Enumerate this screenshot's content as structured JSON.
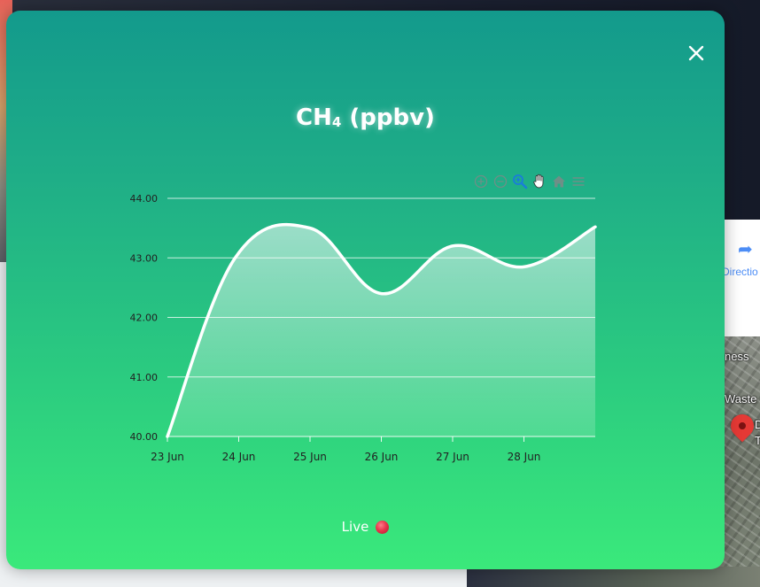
{
  "background": {
    "directions_label": "Directio",
    "map_labels": [
      "ness",
      "Waste",
      "D",
      "T"
    ]
  },
  "modal": {
    "title_main": "CH",
    "title_sub": "4",
    "title_unit": " (ppbv)",
    "close_icon": "close-icon",
    "live_label": "Live",
    "colors": {
      "gradient_top": "#139a8c",
      "gradient_bottom": "#3ae97b",
      "live_dot": "#e8364d"
    }
  },
  "toolbar": {
    "icons": [
      "zoom-in-icon",
      "zoom-out-icon",
      "magnifier-zoom-icon",
      "pan-hand-icon",
      "home-reset-icon",
      "menu-icon"
    ]
  },
  "chart_data": {
    "type": "area",
    "title": "CH4 (ppbv)",
    "x": [
      0,
      0.95,
      2,
      3,
      4,
      5,
      6
    ],
    "values": [
      40.0,
      43.0,
      43.5,
      42.4,
      43.2,
      42.85,
      43.52
    ],
    "xticks": [
      "23 Jun",
      "24 Jun",
      "25 Jun",
      "26 Jun",
      "27 Jun",
      "28 Jun"
    ],
    "yticks": [
      "40.00",
      "41.00",
      "42.00",
      "43.00",
      "44.00"
    ],
    "ylim": [
      40,
      44
    ],
    "xlim": [
      0,
      6
    ],
    "grid": true,
    "line_color": "#ffffff"
  }
}
